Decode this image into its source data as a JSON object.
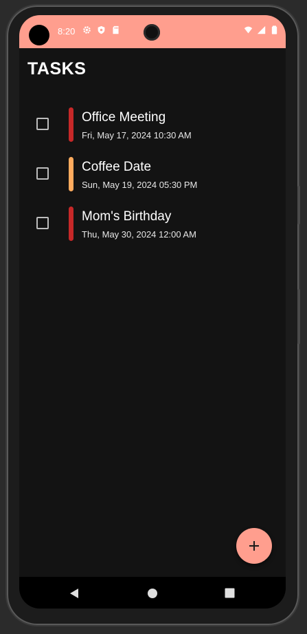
{
  "status_bar": {
    "time": "8:20",
    "left_icons": [
      "gear-icon",
      "shield-icon",
      "sd-card-icon"
    ],
    "right_icons": [
      "wifi-icon",
      "signal-icon",
      "battery-icon"
    ],
    "color": "#ff9e8e"
  },
  "page": {
    "title": "TASKS"
  },
  "tasks": [
    {
      "title": "Office Meeting",
      "date": "Fri, May 17, 2024 10:30 AM",
      "priority_color": "#c62828",
      "completed": false
    },
    {
      "title": "Coffee Date",
      "date": "Sun, May 19, 2024 05:30 PM",
      "priority_color": "#ffab5e",
      "completed": false
    },
    {
      "title": "Mom's Birthday",
      "date": "Thu, May 30, 2024 12:00 AM",
      "priority_color": "#c62828",
      "completed": false
    }
  ],
  "fab": {
    "icon": "plus-icon",
    "color": "#ff9e8e"
  },
  "nav_bar": {
    "buttons": [
      "back-icon",
      "home-icon",
      "recents-icon"
    ]
  },
  "theme": {
    "background": "#131313",
    "accent": "#ff9e8e"
  }
}
